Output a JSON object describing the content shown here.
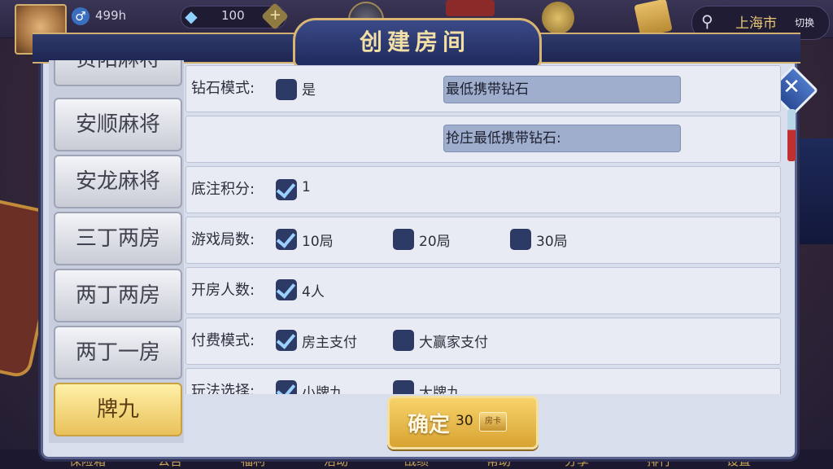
{
  "topbar": {
    "gender_symbol": "♂",
    "hours": "499h",
    "diamond_count": "100",
    "plus": "+",
    "location_city": "上海市",
    "location_switch": "切换"
  },
  "dialog": {
    "title": "创建房间",
    "close_symbol": "✕"
  },
  "game_list": [
    {
      "label": "贵阳麻将",
      "active": false
    },
    {
      "label": "安顺麻将",
      "active": false
    },
    {
      "label": "安龙麻将",
      "active": false
    },
    {
      "label": "三丁两房",
      "active": false
    },
    {
      "label": "两丁两房",
      "active": false
    },
    {
      "label": "两丁一房",
      "active": false
    },
    {
      "label": "牌九",
      "active": true
    }
  ],
  "settings": {
    "diamond_mode": {
      "label": "钻石模式:",
      "option": {
        "text": "是",
        "checked": false
      },
      "min_carry_field": "最低携带钻石",
      "banker_min_field": "抢庄最低携带钻石:"
    },
    "base_score": {
      "label": "底注积分:",
      "options": [
        {
          "text": "1",
          "checked": true
        }
      ]
    },
    "rounds": {
      "label": "游戏局数:",
      "options": [
        {
          "text": "10局",
          "checked": true
        },
        {
          "text": "20局",
          "checked": false
        },
        {
          "text": "30局",
          "checked": false
        }
      ]
    },
    "players": {
      "label": "开房人数:",
      "options": [
        {
          "text": "4人",
          "checked": true
        }
      ]
    },
    "payment": {
      "label": "付费模式:",
      "options": [
        {
          "text": "房主支付",
          "checked": true
        },
        {
          "text": "大赢家支付",
          "checked": false
        }
      ]
    },
    "gameplay": {
      "label": "玩法选择:",
      "options": [
        {
          "text": "小牌九",
          "checked": true
        },
        {
          "text": "大牌九",
          "checked": false
        }
      ]
    }
  },
  "confirm": {
    "label": "确定",
    "cost": "30",
    "card_text": "房卡"
  },
  "bottom_nav": [
    "保险箱",
    "公告",
    "福利",
    "活动",
    "战绩",
    "帮助",
    "分享",
    "排行",
    "设置"
  ],
  "colors": {
    "accent_gold": "#d4b070",
    "checkbox_fill": "#2e3a66",
    "check_mark": "#9bd0ff",
    "active_tab": "#e9c15a"
  }
}
